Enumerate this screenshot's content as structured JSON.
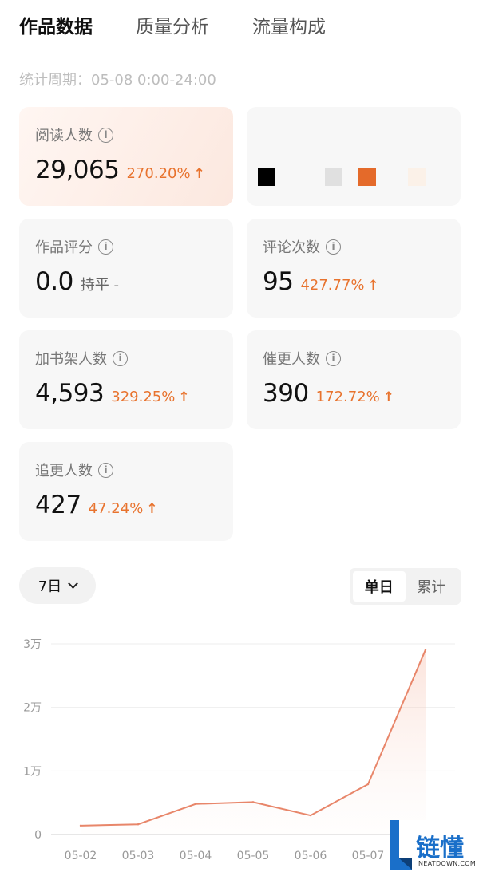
{
  "tabs": [
    {
      "label": "作品数据"
    },
    {
      "label": "质量分析"
    },
    {
      "label": "流量构成"
    }
  ],
  "period": "统计周期：05-08 0:00-24:00",
  "info_glyph": "i",
  "metrics": {
    "reads": {
      "label": "阅读人数",
      "value": "29,065",
      "change": "270.20%",
      "arrow": "↑"
    },
    "rating": {
      "label": "作品评分",
      "value": "0.0",
      "change": "持平 -"
    },
    "comments": {
      "label": "评论次数",
      "value": "95",
      "change": "427.77%",
      "arrow": "↑"
    },
    "shelf": {
      "label": "加书架人数",
      "value": "4,593",
      "change": "329.25%",
      "arrow": "↑"
    },
    "urge": {
      "label": "催更人数",
      "value": "390",
      "change": "172.72%",
      "arrow": "↑"
    },
    "follow": {
      "label": "追更人数",
      "value": "427",
      "change": "47.24%",
      "arrow": "↑"
    }
  },
  "swatch_colors": [
    "#000000",
    "#e0e0e0",
    "#e46a2a",
    "#fbf1e8"
  ],
  "range": {
    "label": "7日"
  },
  "toggle": {
    "daily": "单日",
    "cumulative": "累计"
  },
  "colors": {
    "accent": "#e8732e",
    "line": "#e8866a"
  },
  "chart_data": {
    "type": "area",
    "categories": [
      "05-02",
      "05-03",
      "05-04",
      "05-05",
      "05-06",
      "05-07",
      "05-08"
    ],
    "values": [
      1400,
      1600,
      4800,
      5100,
      3000,
      7900,
      29065
    ],
    "y_ticks": [
      "0",
      "1万",
      "2万",
      "3万"
    ],
    "ylim": [
      0,
      30000
    ],
    "grid": true
  },
  "watermark": {
    "brand": "链懂",
    "site": "NEATDOWN.COM"
  }
}
